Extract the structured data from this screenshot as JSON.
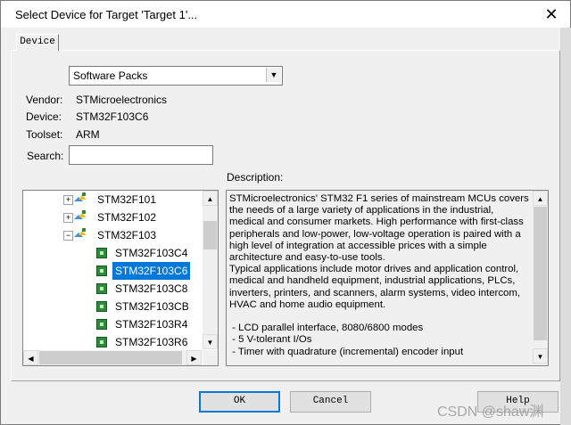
{
  "window": {
    "title": "Select Device for Target 'Target 1'...",
    "close_glyph": "✕"
  },
  "tab": {
    "label": "Device"
  },
  "pack_combo": {
    "value": "Software Packs",
    "arrow": "▼"
  },
  "fields": {
    "vendor_label": "Vendor:",
    "vendor_value": "STMicroelectronics",
    "device_label": "Device:",
    "device_value": "STM32F103C6",
    "toolset_label": "Toolset:",
    "toolset_value": "ARM",
    "search_label": "Search:",
    "search_value": ""
  },
  "description_label": "Description:",
  "tree": {
    "items": [
      {
        "label": "STM32F101",
        "kind": "family",
        "expander": "+"
      },
      {
        "label": "STM32F102",
        "kind": "family",
        "expander": "+"
      },
      {
        "label": "STM32F103",
        "kind": "family",
        "expander": "−"
      },
      {
        "label": "STM32F103C4",
        "kind": "device"
      },
      {
        "label": "STM32F103C6",
        "kind": "device",
        "selected": true
      },
      {
        "label": "STM32F103C8",
        "kind": "device"
      },
      {
        "label": "STM32F103CB",
        "kind": "device"
      },
      {
        "label": "STM32F103R4",
        "kind": "device"
      },
      {
        "label": "STM32F103R6",
        "kind": "device"
      }
    ]
  },
  "description": {
    "text": "STMicroelectronics' STM32 F1 series of mainstream MCUs covers the needs of a large variety of applications in the industrial, medical and consumer markets. High performance with first-class peripherals and low-power, low-voltage operation is paired with a high level of integration at accessible prices with a simple architecture and easy-to-use tools.\nTypical applications include motor drives and application control, medical and handheld equipment, industrial applications, PLCs, inverters, printers, and scanners, alarm systems, video intercom, HVAC and home audio equipment.\n\n - LCD parallel interface, 8080/6800 modes\n - 5 V-tolerant I/Os\n - Timer with quadrature (incremental) encoder input"
  },
  "scroll_glyphs": {
    "up": "▲",
    "down": "▼",
    "left": "◀",
    "right": "▶"
  },
  "buttons": {
    "ok": "OK",
    "cancel": "Cancel",
    "help": "Help"
  },
  "watermark": "CSDN @shaw渊",
  "colors": {
    "selection": "#0078d7",
    "chip": "#2e8b3c"
  }
}
